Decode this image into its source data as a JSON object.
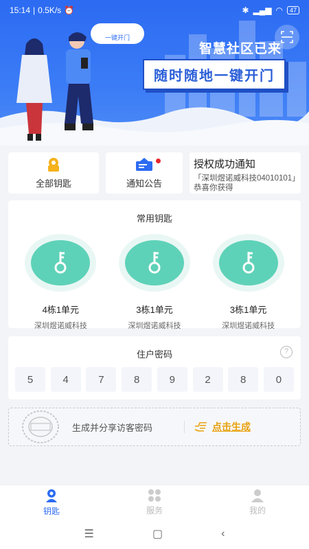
{
  "status_bar": {
    "time": "15:14",
    "speed": "0.5K/s",
    "battery": "47"
  },
  "banner": {
    "title": "智慧社区已来",
    "slogan": "随时随地一键开门",
    "bubble_text": "一键开门"
  },
  "quick": {
    "all_keys_label": "全部钥匙",
    "notice_label": "通知公告",
    "message_title": "授权成功通知",
    "message_body": "「深圳煜诺威科技04010101」恭喜你获得"
  },
  "common_keys": {
    "title": "常用钥匙",
    "items": [
      {
        "name": "4栋1单元",
        "org": "深圳煜诺威科技"
      },
      {
        "name": "3栋1单元",
        "org": "深圳煜诺威科技"
      },
      {
        "name": "3栋1单元",
        "org": "深圳煜诺威科技"
      }
    ]
  },
  "resident_password": {
    "title": "住户密码",
    "digits": [
      "5",
      "4",
      "7",
      "8",
      "9",
      "2",
      "8",
      "0"
    ]
  },
  "visitor": {
    "text": "生成并分享访客密码",
    "action": "点击生成"
  },
  "tabs": [
    {
      "label": "钥匙",
      "icon": "key-person-icon",
      "active": true
    },
    {
      "label": "服务",
      "icon": "grid-icon",
      "active": false
    },
    {
      "label": "我的",
      "icon": "user-icon",
      "active": false
    }
  ],
  "colors": {
    "primary": "#2c6bf2",
    "key_green": "#5ed2b8",
    "accent": "#e8a10e",
    "dot": "#e8262d"
  }
}
